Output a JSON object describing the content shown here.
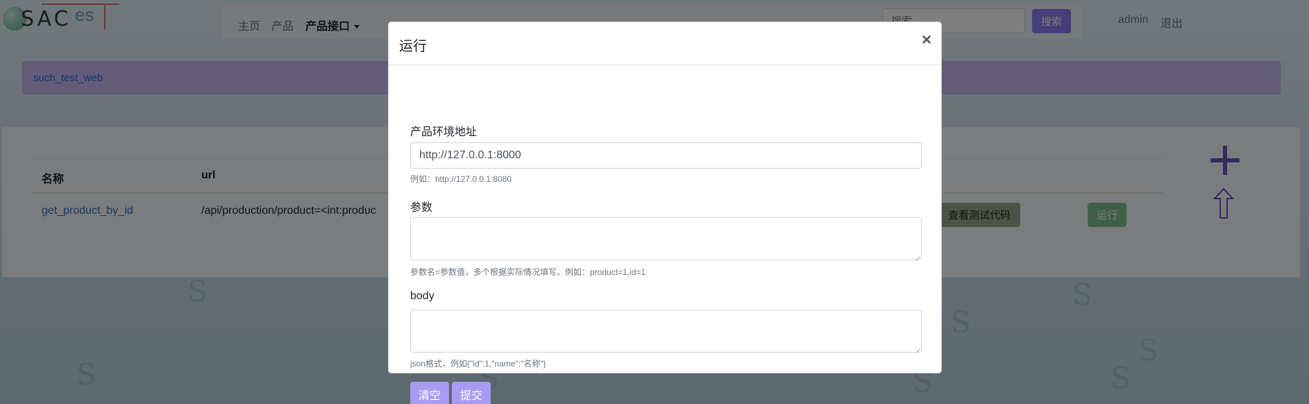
{
  "logo": {
    "text": "SAC",
    "suffix": "es"
  },
  "navbar": {
    "items": [
      {
        "label": "主页",
        "active": false
      },
      {
        "label": "产品",
        "active": false
      },
      {
        "label": "产品接口",
        "active": true,
        "dropdown": true
      }
    ],
    "search": {
      "placeholder": "搜索",
      "button_label": "搜索"
    },
    "user": "admin",
    "logout": "退出"
  },
  "breadcrumb": {
    "label": "such_test_web"
  },
  "table": {
    "headers": [
      "名称",
      "url"
    ],
    "rows": [
      {
        "name": "get_product_by_id",
        "url": "/api/production/product=<int:produc",
        "code_button": "查看测试代码",
        "run_button": "运行"
      }
    ]
  },
  "icons": {
    "add": "plus-icon",
    "upload": "arrow-up-icon"
  },
  "modal": {
    "title": "运行",
    "close": "×",
    "env_label": "产品环境地址",
    "env_value": "http://127.0.0.1:8000",
    "env_help": "例如：http://127.0.0.1:8080",
    "params_label": "参数",
    "params_value": "",
    "params_help": "参数名=参数值，多个根据实际情况填写。例如：product=1,id=1",
    "body_label": "body",
    "body_value": "",
    "body_help": "json格式，例如{\"id\":1,\"name\":\"名称\"}",
    "clear_label": "清空",
    "submit_label": "提交"
  },
  "colors": {
    "primary": "#a99bf3",
    "accent_dark": "#6b55c8",
    "link": "#2d6ad1",
    "alert_bg": "#c5b9f5"
  }
}
